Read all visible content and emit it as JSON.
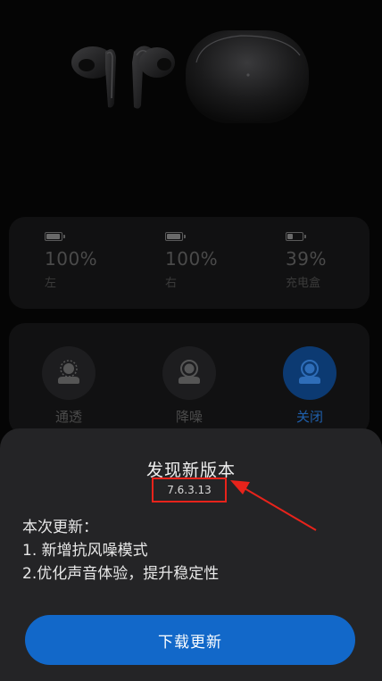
{
  "battery": {
    "items": [
      {
        "percent": "100%",
        "label": "左",
        "level": 1.0
      },
      {
        "percent": "100%",
        "label": "右",
        "level": 1.0
      },
      {
        "percent": "39%",
        "label": "充电盒",
        "level": 0.39
      }
    ]
  },
  "modes": {
    "items": [
      {
        "label": "通透",
        "icon": "transparency-icon",
        "active": false
      },
      {
        "label": "降噪",
        "icon": "noise-cancel-icon",
        "active": false
      },
      {
        "label": "关闭",
        "icon": "anc-off-icon",
        "active": true
      }
    ]
  },
  "update_sheet": {
    "title": "发现新版本",
    "version": "7.6.3.13",
    "notes_title": "本次更新：",
    "notes": [
      "1. 新增抗风噪模式",
      "2.优化声音体验，提升稳定性"
    ],
    "download_label": "下载更新"
  },
  "colors": {
    "accent": "#1268c9",
    "annotation": "#e8231b",
    "sheet_bg": "#242426"
  }
}
